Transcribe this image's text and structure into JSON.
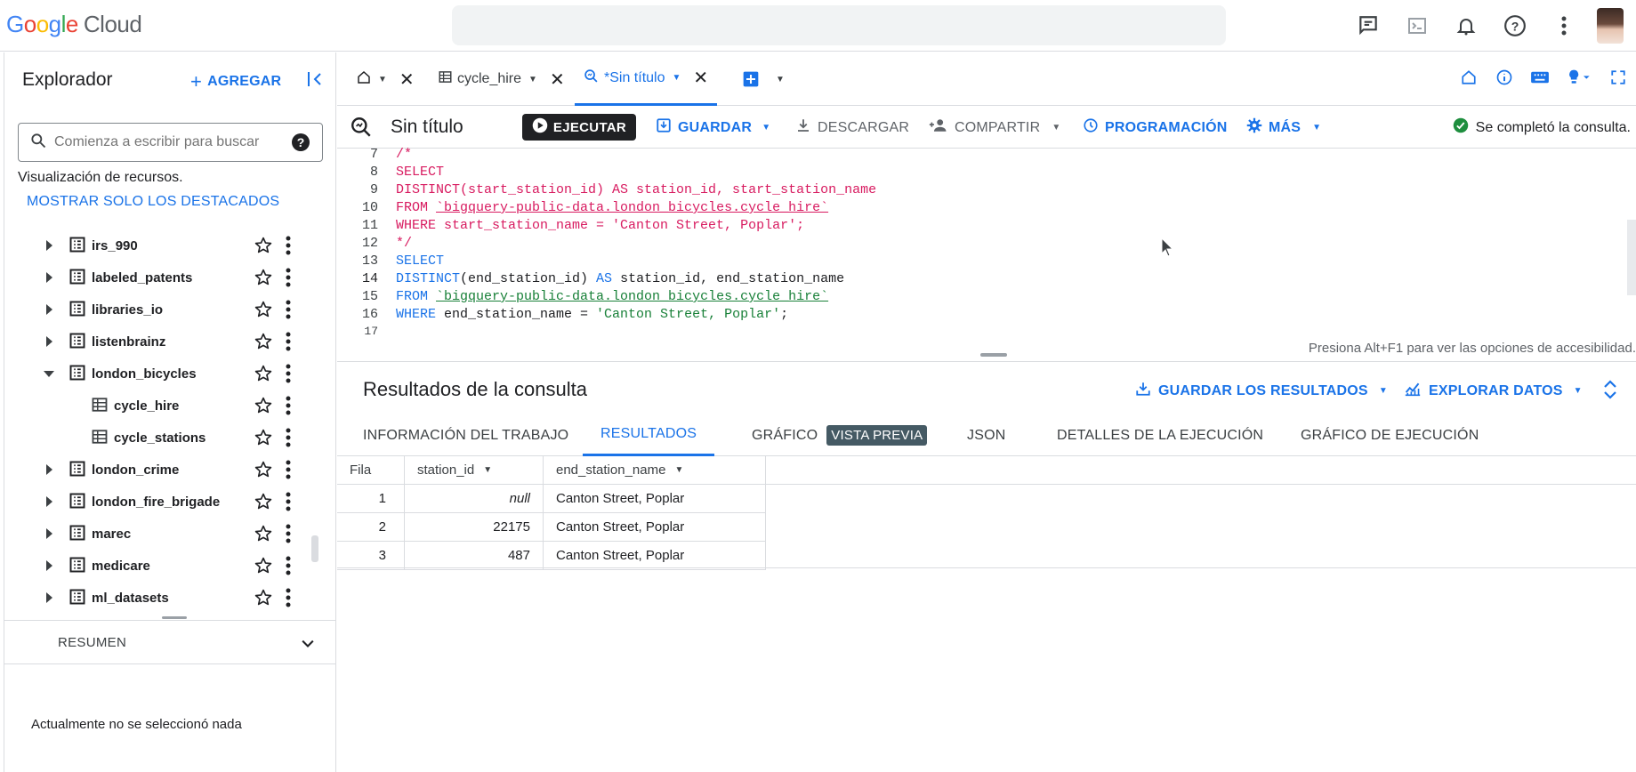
{
  "header": {
    "logo_google": [
      "G",
      "o",
      "o",
      "g",
      "l",
      "e"
    ],
    "logo_cloud": "Cloud",
    "icons": [
      "feedback-icon",
      "terminal-icon",
      "notifications-icon",
      "help-icon",
      "more-vert-icon",
      "avatar"
    ]
  },
  "explorer": {
    "title": "Explorador",
    "add_label": "AGREGAR",
    "search_placeholder": "Comienza a escribir para buscar",
    "resources_label": "Visualización de recursos.",
    "show_starred": "MOSTRAR SOLO LOS DESTACADOS",
    "items": [
      {
        "label": "irs_990",
        "type": "dataset",
        "expanded": false
      },
      {
        "label": "labeled_patents",
        "type": "dataset",
        "expanded": false
      },
      {
        "label": "libraries_io",
        "type": "dataset",
        "expanded": false
      },
      {
        "label": "listenbrainz",
        "type": "dataset",
        "expanded": false
      },
      {
        "label": "london_bicycles",
        "type": "dataset",
        "expanded": true
      },
      {
        "label": "cycle_hire",
        "type": "table"
      },
      {
        "label": "cycle_stations",
        "type": "table"
      },
      {
        "label": "london_crime",
        "type": "dataset",
        "expanded": false
      },
      {
        "label": "london_fire_brigade",
        "type": "dataset",
        "expanded": false
      },
      {
        "label": "marec",
        "type": "dataset",
        "expanded": false
      },
      {
        "label": "medicare",
        "type": "dataset",
        "expanded": false
      },
      {
        "label": "ml_datasets",
        "type": "dataset",
        "expanded": false
      }
    ],
    "summary_label": "RESUMEN",
    "nothing_selected": "Actualmente no se seleccionó nada"
  },
  "tabs": {
    "items": [
      {
        "label": "",
        "icon": "home-icon"
      },
      {
        "label": "cycle_hire",
        "icon": "table-icon"
      },
      {
        "label": "*Sin título",
        "icon": "query-icon",
        "active": true
      }
    ]
  },
  "toolbar": {
    "title": "Sin título",
    "run": "EJECUTAR",
    "save": "GUARDAR",
    "download": "DESCARGAR",
    "share": "COMPARTIR",
    "schedule": "PROGRAMACIÓN",
    "more": "MÁS",
    "status": "Se completó la consulta."
  },
  "editor": {
    "current_line": 14,
    "lines": [
      {
        "n": "7",
        "text": "/*"
      },
      {
        "n": "8",
        "text": "SELECT"
      },
      {
        "n": "9",
        "text": "DISTINCT(start_station_id) AS station_id, start_station_name"
      },
      {
        "n": "10",
        "text_pre": "FROM ",
        "text_ref": "`bigquery-public-data.london_bicycles.cycle_hire`"
      },
      {
        "n": "11",
        "text": "WHERE start_station_name = 'Canton Street, Poplar';"
      },
      {
        "n": "12",
        "text": "*/"
      },
      {
        "n": "13",
        "text": "SELECT"
      },
      {
        "n": "14",
        "kw1": "DISTINCT",
        "p1": "(end_station_id) ",
        "kw2": "AS",
        "p2": " station_id, end_station_name"
      },
      {
        "n": "15",
        "kw": "FROM ",
        "ref": "`bigquery-public-data.london_bicycles.cycle_hire`"
      },
      {
        "n": "16",
        "kw": "WHERE",
        "p": " end_station_name = ",
        "str": "'Canton Street, Poplar'",
        "end": ";"
      },
      {
        "n": "17",
        "text": ""
      }
    ],
    "accessibility_hint": "Presiona Alt+F1 para ver las opciones de accesibilidad."
  },
  "results": {
    "title": "Resultados de la consulta",
    "save_results": "GUARDAR LOS RESULTADOS",
    "explore_data": "EXPLORAR DATOS",
    "tabs": [
      "INFORMACIÓN DEL TRABAJO",
      "RESULTADOS",
      "GRÁFICO",
      "JSON",
      "DETALLES DE LA EJECUCIÓN",
      "GRÁFICO DE EJECUCIÓN"
    ],
    "preview_badge": "VISTA PREVIA",
    "columns": [
      "Fila",
      "station_id",
      "end_station_name"
    ],
    "rows": [
      {
        "row": "1",
        "station_id": "null",
        "end_station_name": "Canton Street, Poplar"
      },
      {
        "row": "2",
        "station_id": "22175",
        "end_station_name": "Canton Street, Poplar"
      },
      {
        "row": "3",
        "station_id": "487",
        "end_station_name": "Canton Street, Poplar"
      }
    ]
  },
  "colors": {
    "accent": "#1a73e8",
    "sql_comment": "#d81b60",
    "string": "#188038",
    "success": "#1e8e3e"
  }
}
